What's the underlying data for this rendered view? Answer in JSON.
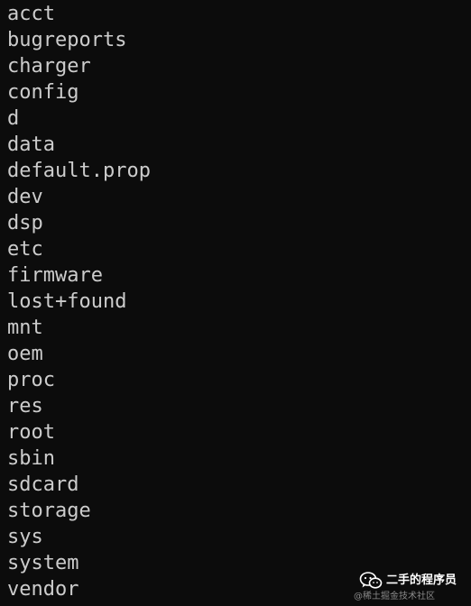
{
  "terminal": {
    "entries": [
      "acct",
      "bugreports",
      "charger",
      "config",
      "d",
      "data",
      "default.prop",
      "dev",
      "dsp",
      "etc",
      "firmware",
      "lost+found",
      "mnt",
      "oem",
      "proc",
      "res",
      "root",
      "sbin",
      "sdcard",
      "storage",
      "sys",
      "system",
      "vendor"
    ]
  },
  "watermark": {
    "logo_icon": "wechat-icon",
    "title": "二手的程序员",
    "subtitle": "@稀土掘金技术社区"
  },
  "colors": {
    "background": "#0c0c0c",
    "text": "#cccccc"
  }
}
